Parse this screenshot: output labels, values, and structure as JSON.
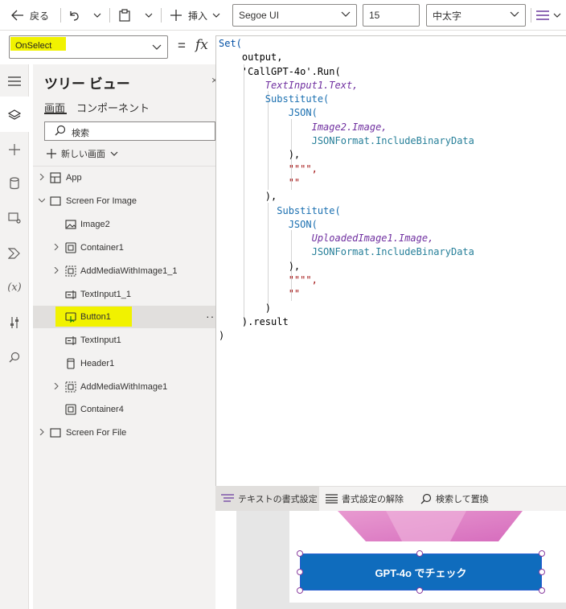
{
  "toolbar": {
    "back_label": "戻る",
    "insert_label": "挿入",
    "font_family_value": "Segoe UI",
    "font_size_value": "15",
    "font_weight_value": "中太字"
  },
  "formula_bar": {
    "property_value": "OnSelect",
    "equals": "=",
    "fx": "fx"
  },
  "tree": {
    "title": "ツリー ビュー",
    "tabs": [
      "画面",
      "コンポーネント"
    ],
    "search_placeholder": "検索",
    "new_screen_label": "新しい画面",
    "items": [
      {
        "label": "App",
        "icon": "app-icon"
      },
      {
        "label": "Screen For Image",
        "icon": "screen-icon"
      },
      {
        "label": "Image2",
        "icon": "image-icon"
      },
      {
        "label": "Container1",
        "icon": "container-icon"
      },
      {
        "label": "AddMediaWithImage1_1",
        "icon": "media-group-icon"
      },
      {
        "label": "TextInput1_1",
        "icon": "text-input-icon"
      },
      {
        "label": "Button1",
        "icon": "button-icon",
        "selected": true
      },
      {
        "label": "TextInput1",
        "icon": "text-input-icon"
      },
      {
        "label": "Header1",
        "icon": "header-icon"
      },
      {
        "label": "AddMediaWithImage1",
        "icon": "media-group-icon"
      },
      {
        "label": "Container4",
        "icon": "container-icon"
      },
      {
        "label": "Screen For File",
        "icon": "screen-icon"
      }
    ]
  },
  "code": {
    "lines": [
      "Set(",
      "    output,",
      "    'CallGPT-4o'.Run(",
      "        TextInput1.Text,",
      "        Substitute(",
      "            JSON(",
      "                Image2.Image,",
      "                JSONFormat.IncludeBinaryData",
      "            ),",
      "            \"\"\"\",",
      "            \"\"",
      "        ),",
      "          Substitute(",
      "            JSON(",
      "                UploadedImage1.Image,",
      "                JSONFormat.IncludeBinaryData",
      "            ),",
      "            \"\"\"\",",
      "            \"\"",
      "        )",
      "    ).result",
      ")"
    ]
  },
  "bottom_bar": {
    "format_text": "テキストの書式設定",
    "remove_format": "書式設定の解除",
    "find_replace": "検索して置換"
  },
  "canvas": {
    "button_text": "GPT-4o でチェック"
  },
  "colors": {
    "accent": "#0f6cbd",
    "highlight": "#f1f200",
    "selection_handle": "#8b3fa0"
  }
}
